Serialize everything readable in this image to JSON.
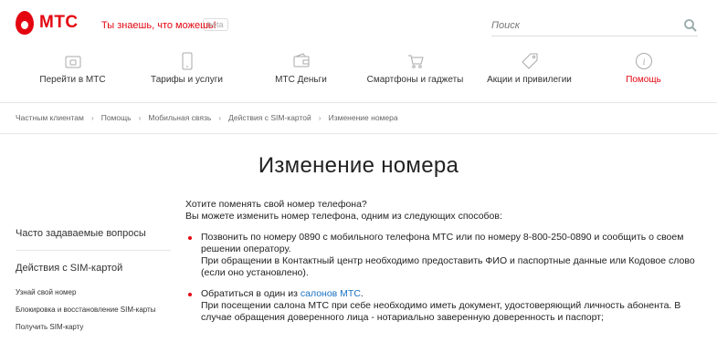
{
  "header": {
    "logo_text": "МТС",
    "slogan": "Ты знаешь, что можешь!",
    "beta": "beta",
    "search_placeholder": "Поиск"
  },
  "nav": [
    {
      "label": "Перейти в МТС",
      "icon": "sim-icon"
    },
    {
      "label": "Тарифы и услуги",
      "icon": "phone-icon"
    },
    {
      "label": "МТС Деньги",
      "icon": "wallet-icon"
    },
    {
      "label": "Смартфоны и гаджеты",
      "icon": "cart-icon"
    },
    {
      "label": "Акции и привилегии",
      "icon": "tag-icon"
    },
    {
      "label": "Помощь",
      "icon": "info-icon",
      "active": true
    }
  ],
  "breadcrumb": [
    "Частным клиентам",
    "Помощь",
    "Мобильная связь",
    "Действия с SIM-картой",
    "Изменение номера"
  ],
  "page_title": "Изменение номера",
  "sidebar": {
    "faq": "Часто задаваемые вопросы",
    "sim_actions": "Действия с SIM-картой",
    "sub_items": [
      "Узнай свой номер",
      "Блокировка и восстановление SIM-карты",
      "Получить SIM-карту"
    ]
  },
  "content": {
    "intro_1": "Хотите поменять свой номер телефона?",
    "intro_2": "Вы можете изменить номер телефона, одним из следующих способов:",
    "method_1_line_1": "Позвонить по номеру 0890 с мобильного телефона МТС или по номеру 8-800-250-0890 и сообщить о своем решении оператору.",
    "method_1_line_2": "При обращении в Контактный центр необходимо предоставить ФИО и паспортные данные или Кодовое слово (если оно установлено).",
    "method_2_prefix": "Обратиться в один из ",
    "method_2_link": "салонов МТС",
    "method_2_suffix": ".",
    "method_2_line_2": "При посещении салона МТС при себе необходимо иметь документ, удостоверяющий личность абонента. В случае обращения доверенного лица - нотариально заверенную доверенность и паспорт;"
  },
  "colors": {
    "brand": "#e30611",
    "link": "#1a73c2"
  }
}
